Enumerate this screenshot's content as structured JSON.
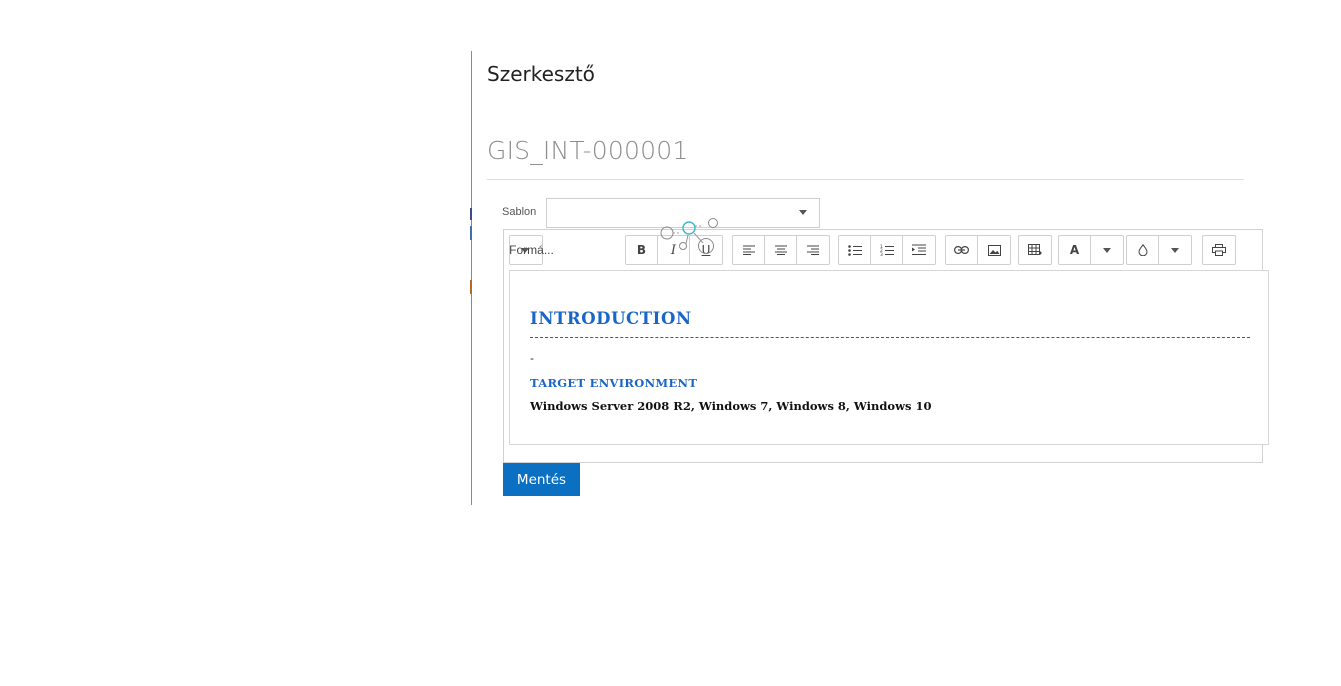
{
  "panel": {
    "title": "Szerkesztő",
    "document_id": "GIS_INT-000001"
  },
  "template": {
    "label": "Sablon",
    "selected": ""
  },
  "toolbar": {
    "format_label": "Formá...",
    "bold_label": "B",
    "italic_label": "I",
    "underline_label": "U",
    "font_color_label": "A"
  },
  "content": {
    "heading": "INTRODUCTION",
    "dash_line": "-",
    "subheading": "TARGET ENVIRONMENT",
    "paragraph": "Windows Server 2008 R2, Windows 7, Windows 8, Windows 10"
  },
  "actions": {
    "save_label": "Mentés"
  },
  "colors": {
    "accent": "#0b6fc2",
    "heading": "#1a66c7"
  }
}
